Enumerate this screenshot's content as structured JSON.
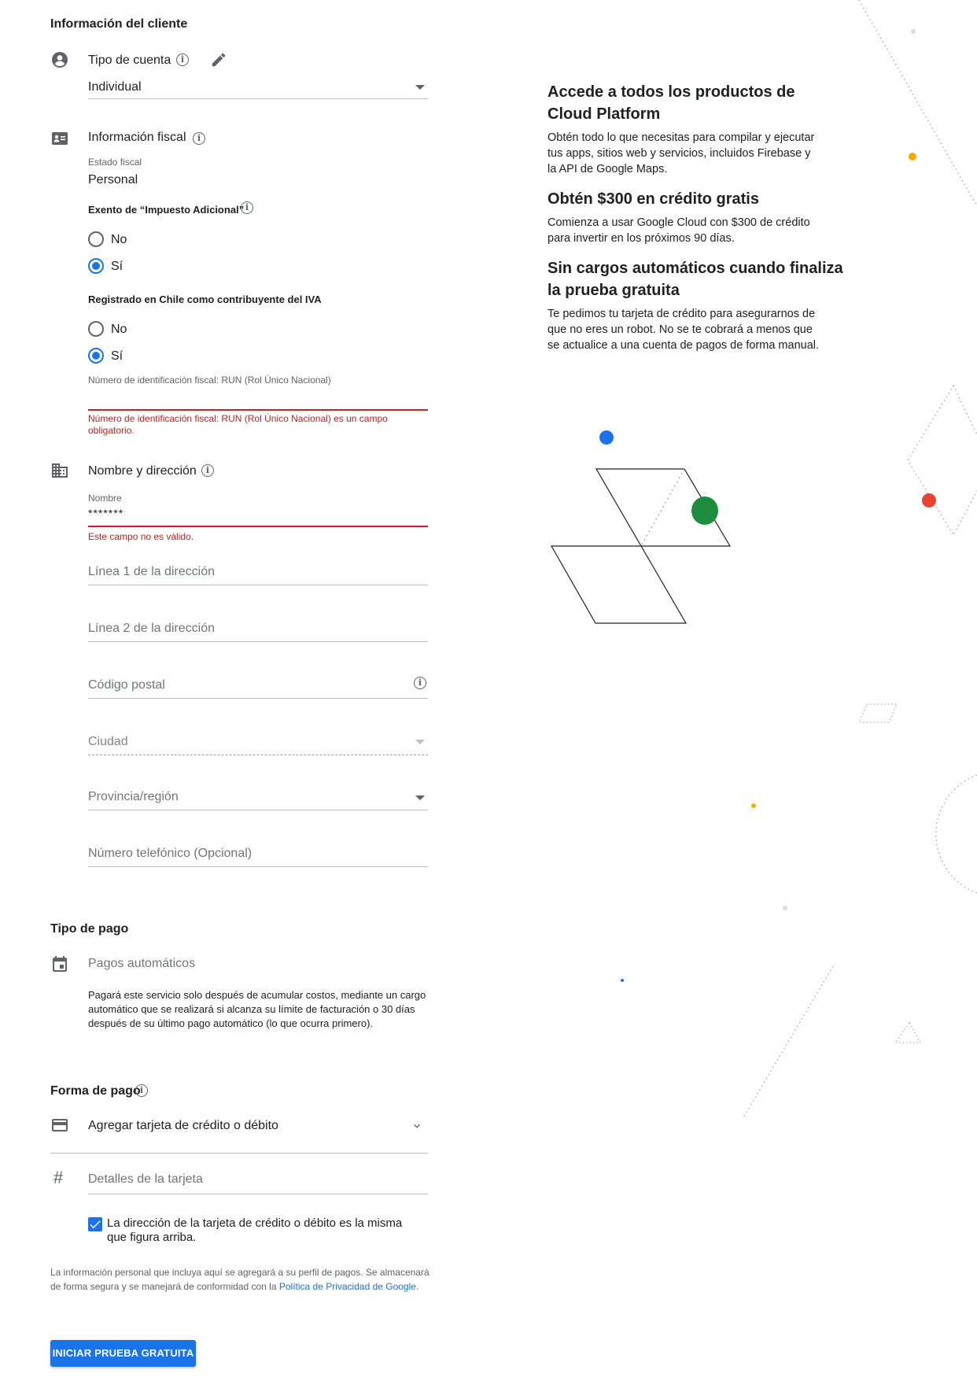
{
  "customer_info": {
    "title": "Información del cliente",
    "account_type": {
      "label": "Tipo de cuenta",
      "value": "Individual"
    },
    "tax_info": {
      "label": "Información fiscal",
      "tax_status_label": "Estado fiscal",
      "tax_status_value": "Personal",
      "additional_tax_exempt": {
        "label": "Exento de “Impuesto Adicional”",
        "options": [
          "No",
          "Sí"
        ],
        "selected": "Sí"
      },
      "vat_registered": {
        "label": "Registrado en Chile como contribuyente del IVA",
        "options": [
          "No",
          "Sí"
        ],
        "selected": "Sí"
      },
      "tax_id_label": "Número de identificación fiscal: RUN (Rol Único Nacional)",
      "tax_id_value": "",
      "tax_id_error_line1": "Número de identificación fiscal: RUN (Rol Único Nacional) es un campo",
      "tax_id_error_line2": "obligatorio."
    },
    "name_address": {
      "label": "Nombre y dirección",
      "name_label": "Nombre",
      "name_value": "*******",
      "name_error": "Este campo no es válido.",
      "address_line1_placeholder": "Línea 1 de la dirección",
      "address_line2_placeholder": "Línea 2 de la dirección",
      "postal_code_placeholder": "Código postal",
      "city_placeholder": "Ciudad",
      "province_placeholder": "Provincia/región",
      "phone_placeholder": "Número telefónico (Opcional)"
    }
  },
  "payment_type": {
    "title": "Tipo de pago",
    "value": "Pagos automáticos",
    "description_line1": "Pagará este servicio solo después de acumular costos, mediante un cargo",
    "description_line2": "automático que se realizará si alcanza su límite de facturación o 30 días",
    "description_line3": "después de su último pago automático (lo que ocurra primero)."
  },
  "payment_method": {
    "title": "Forma de pago",
    "selected": "Agregar tarjeta de crédito o débito",
    "card_details_placeholder": "Detalles de la tarjeta",
    "same_address_line1": "La dirección de la tarjeta de crédito o débito es la misma",
    "same_address_line2": "que figura arriba.",
    "same_address_checked": true
  },
  "footer": {
    "note_line1": "La información personal que incluya aquí se agregará a su perfil de pagos. Se almacenará",
    "note_line2_prefix": "de forma segura y se manejará de conformidad con la",
    "privacy_link": "Política de Privacidad de Google",
    "note_line2_suffix": ".",
    "submit_label": "INICIAR PRUEBA GRATUITA"
  },
  "sidebar": {
    "heading1_line1": "Accede a todos los productos de",
    "heading1_line2": "Cloud Platform",
    "para1_line1": "Obtén todo lo que necesitas para compilar y ejecutar",
    "para1_line2": "tus apps, sitios web y servicios, incluidos Firebase y",
    "para1_line3": "la API de Google Maps.",
    "heading2": "Obtén $300 en crédito gratis",
    "para2_line1": "Comienza a usar Google Cloud con $300 de crédito",
    "para2_line2": "para invertir en los próximos 90 días.",
    "heading3_line1": "Sin cargos automáticos cuando finaliza",
    "heading3_line2": "la prueba gratuita",
    "para3_line1": "Te pedimos tu tarjeta de crédito para asegurarnos de",
    "para3_line2": "que no eres un robot. No se te cobrará a menos que",
    "para3_line3": "se actualice a una cuenta de pagos de forma manual."
  },
  "colors": {
    "primary": "#1a73e8",
    "error": "#c5221f",
    "text": "#202124",
    "muted": "#5f6368"
  },
  "icons": [
    "account-circle-icon",
    "edit-pencil-icon",
    "info-icon",
    "id-card-icon",
    "building-icon",
    "calendar-icon",
    "credit-card-icon",
    "hash-icon",
    "chevron-down-icon",
    "checkbox-check-icon"
  ]
}
